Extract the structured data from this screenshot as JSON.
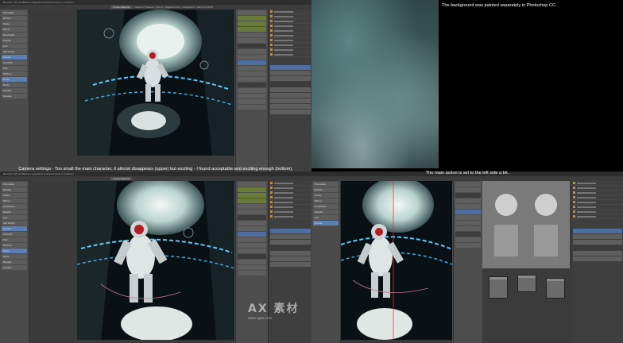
{
  "window": {
    "title": "Blender* [E:\\Art\\Behancing\\Astronaut\\Astronaut_2.2.blend]",
    "menus": [
      "File",
      "Render",
      "Window",
      "Help"
    ],
    "engine": "Cycles Render",
    "stats": "Verts:0 | Faces:0 | Tris:0 | Objects:1/21 | Lamps:0/1 | Mem:75.63M"
  },
  "toolshelf": {
    "buttons": [
      "Translate",
      "Rotate",
      "Scale",
      "Mirror",
      "Duplicate",
      "Delete",
      "Join",
      "Set Origin",
      "Shade",
      "Smooth",
      "Flat",
      "History",
      "Undo",
      "Redo",
      "Repeat",
      "Grease"
    ]
  },
  "captions": {
    "background_note": "The background was painted separately in Photoshop CC.",
    "camera_note": "Camera settings - Too small the main character, it almost disappears (upper) but exciting - I found acceptable and exciting enough (bottom).",
    "action_note": "The main action is set to the left side a bit."
  },
  "watermark": {
    "text": "AX 素材",
    "sub": "www.cgax.com"
  },
  "colors": {
    "ui_bg": "#4a4a4a",
    "accent_blue": "#5a7fb0",
    "accent_green": "#6a7a3a",
    "outliner_icon": "#d08a30",
    "render_bg": "#06090b"
  }
}
